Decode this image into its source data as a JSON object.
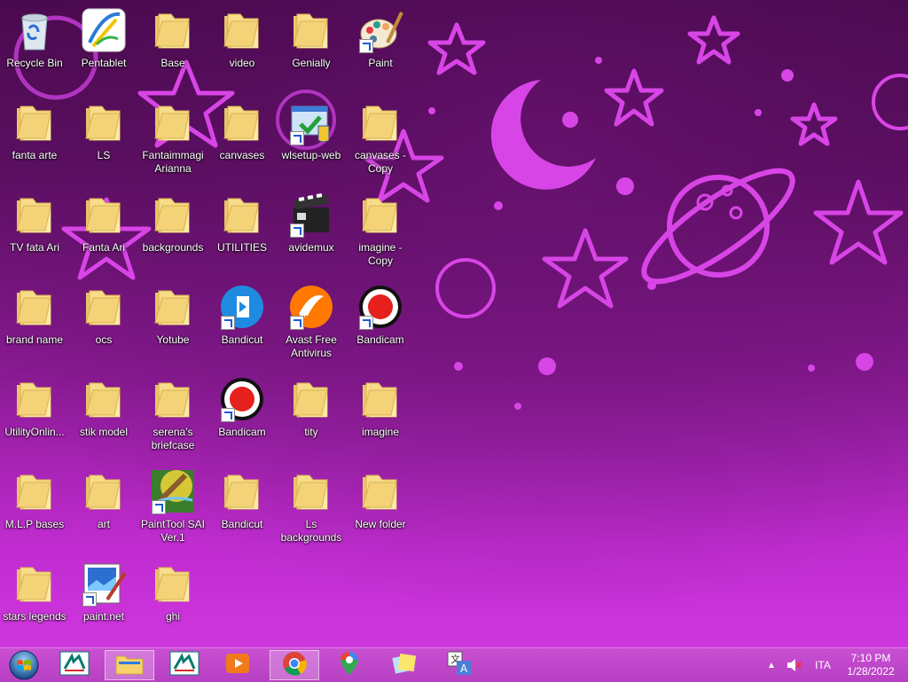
{
  "desktop": {
    "icons": [
      {
        "label": "Recycle Bin",
        "icon": "recycle-bin-icon"
      },
      {
        "label": "Pentablet",
        "icon": "pentablet-icon"
      },
      {
        "label": "Base",
        "icon": "folder-icon"
      },
      {
        "label": "video",
        "icon": "folder-icon"
      },
      {
        "label": "Genially",
        "icon": "folder-icon"
      },
      {
        "label": "Paint",
        "icon": "paint-icon"
      },
      {
        "label": "fanta arte",
        "icon": "folder-icon"
      },
      {
        "label": "LS",
        "icon": "folder-icon"
      },
      {
        "label": "Fantaimmagi Arianna",
        "icon": "folder-icon"
      },
      {
        "label": "canvases",
        "icon": "folder-icon"
      },
      {
        "label": "wlsetup-web",
        "icon": "wlsetup-icon"
      },
      {
        "label": "canvases - Copy",
        "icon": "folder-icon"
      },
      {
        "label": "TV  fata Ari",
        "icon": "folder-icon"
      },
      {
        "label": "Fanta Ari",
        "icon": "folder-icon"
      },
      {
        "label": "backgrounds",
        "icon": "folder-icon"
      },
      {
        "label": "UTILITIES",
        "icon": "folder-icon"
      },
      {
        "label": "avidemux",
        "icon": "avidemux-icon"
      },
      {
        "label": "imagine - Copy",
        "icon": "folder-icon"
      },
      {
        "label": "brand name",
        "icon": "folder-icon"
      },
      {
        "label": "ocs",
        "icon": "folder-icon"
      },
      {
        "label": "Yotube",
        "icon": "folder-icon"
      },
      {
        "label": "Bandicut",
        "icon": "bandicut-icon"
      },
      {
        "label": "Avast Free Antivirus",
        "icon": "avast-icon"
      },
      {
        "label": "Bandicam",
        "icon": "bandicam-icon"
      },
      {
        "label": "UtilityOnlin...",
        "icon": "folder-icon"
      },
      {
        "label": "stik  model",
        "icon": "folder-icon"
      },
      {
        "label": "serena's briefcase",
        "icon": "folder-icon"
      },
      {
        "label": "Bandicam",
        "icon": "bandicam-icon"
      },
      {
        "label": "tity",
        "icon": "folder-icon"
      },
      {
        "label": "imagine",
        "icon": "folder-icon"
      },
      {
        "label": "M.L.P bases",
        "icon": "folder-icon"
      },
      {
        "label": "art",
        "icon": "folder-icon"
      },
      {
        "label": "PaintTool SAI Ver.1",
        "icon": "painttool-sai-icon"
      },
      {
        "label": "Bandicut",
        "icon": "folder-icon"
      },
      {
        "label": "Ls backgrounds",
        "icon": "folder-icon"
      },
      {
        "label": "New folder",
        "icon": "folder-icon"
      },
      {
        "label": "stars legends",
        "icon": "folder-icon"
      },
      {
        "label": "paint.net",
        "icon": "paintnet-icon"
      },
      {
        "label": "ghi",
        "icon": "folder-icon"
      }
    ]
  },
  "taskbar": {
    "start_icon": "windows-start-icon",
    "pinned": [
      {
        "icon": "credit-agricole-icon",
        "active": false
      },
      {
        "icon": "file-explorer-icon",
        "active": true
      },
      {
        "icon": "credit-agricole-icon",
        "active": false
      },
      {
        "icon": "media-player-icon",
        "active": false
      },
      {
        "icon": "chrome-icon",
        "active": true
      },
      {
        "icon": "google-maps-icon",
        "active": false
      },
      {
        "icon": "sticky-notes-icon",
        "active": false
      },
      {
        "icon": "translate-icon",
        "active": false
      }
    ],
    "tray": {
      "language": "ITA",
      "time": "7:10 PM",
      "date": "1/28/2022"
    }
  },
  "colors": {
    "wallpaper_motif": "#e055ec",
    "taskbar": "#c14bcc"
  }
}
